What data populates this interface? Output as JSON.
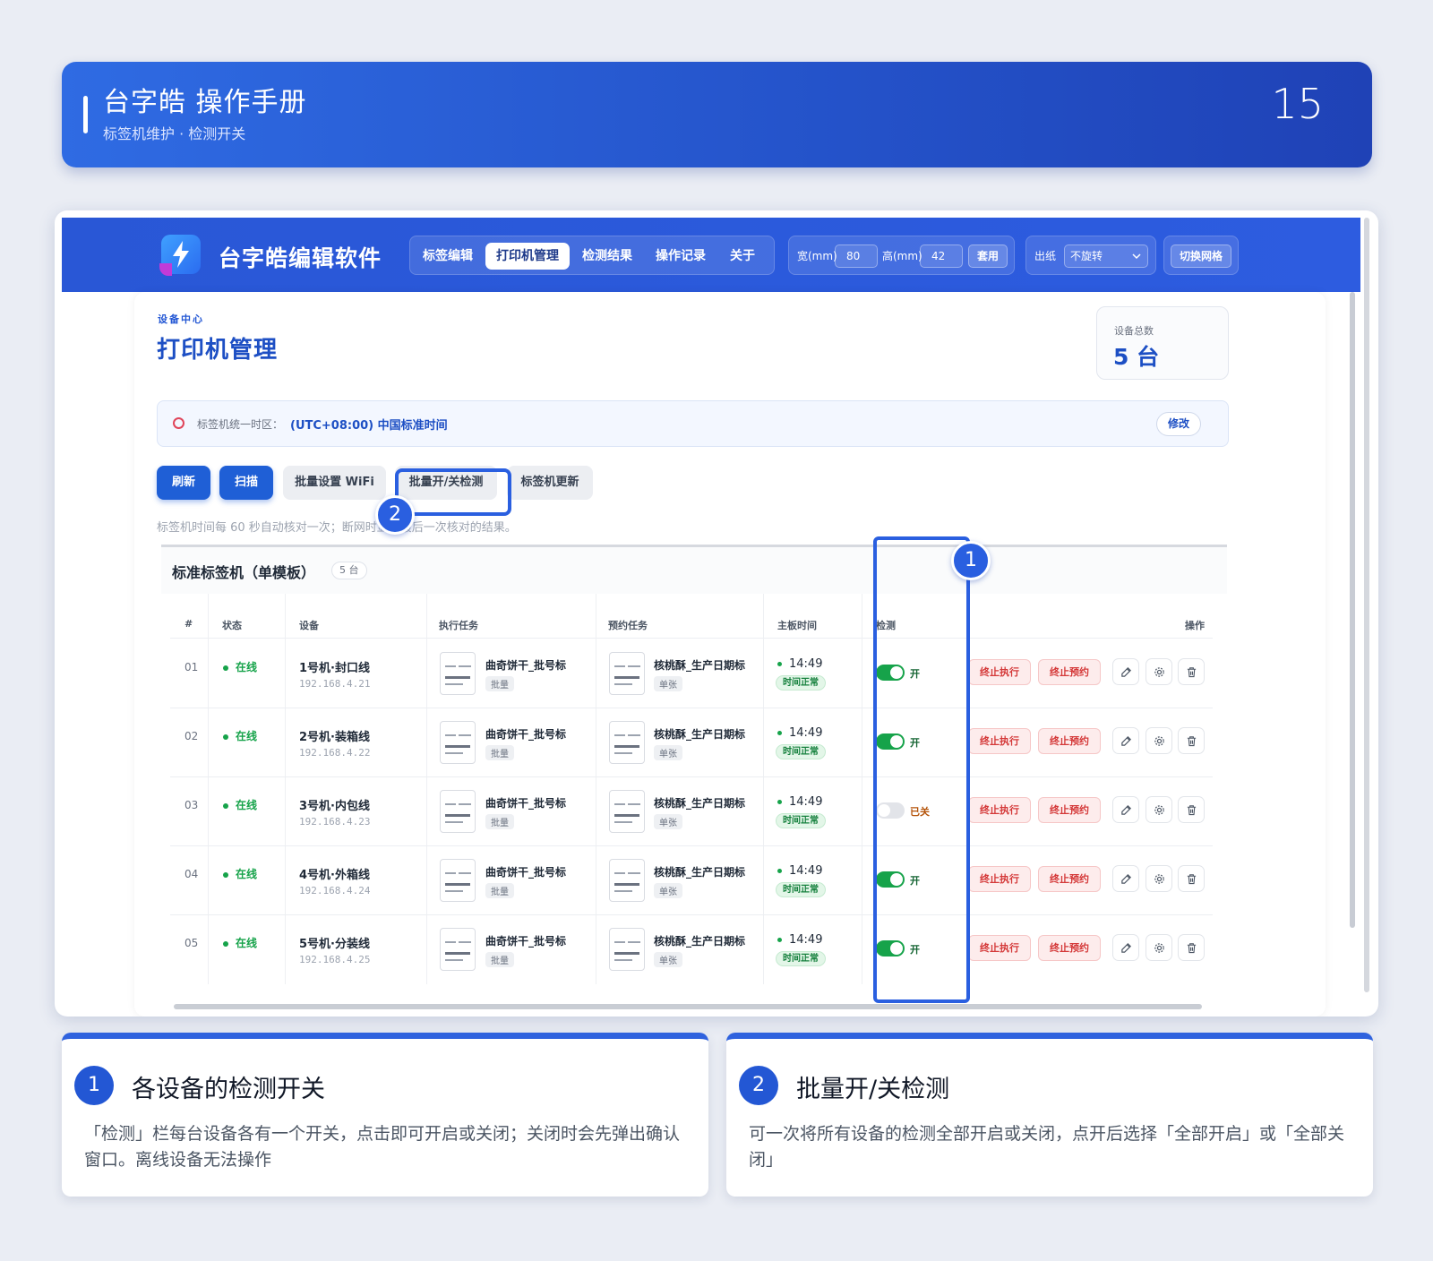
{
  "banner": {
    "title": "台字皓 操作手册",
    "subtitle": "标签机维护 · 检测开关",
    "page_number": "15"
  },
  "app": {
    "name": "台字皓编辑软件",
    "nav": [
      "标签编辑",
      "打印机管理",
      "检测结果",
      "操作记录",
      "关于"
    ],
    "nav_active": "打印机管理",
    "width_label": "宽(mm)",
    "width_value": "80",
    "height_label": "高(mm)",
    "height_value": "42",
    "apply_label": "套用",
    "paper_label": "出纸",
    "paper_option": "不旋转",
    "grid_label": "切换网格"
  },
  "page": {
    "eyebrow": "设备中心",
    "title": "打印机管理",
    "total_label": "设备总数",
    "total_value": "5 台",
    "tz_label": "标签机统一时区：",
    "tz_value": "(UTC+08:00) 中国标准时间",
    "tz_edit": "修改",
    "buttons": {
      "refresh": "刷新",
      "scan": "扫描",
      "wifi": "批量设置 WiFi",
      "batch_detect": "批量开/关检测",
      "update": "标签机更新"
    },
    "hint": "标签机时间每 60 秒自动核对一次；断网时显示最后一次核对的结果。"
  },
  "table": {
    "group_title": "标准标签机（单模板）",
    "group_count": "5 台",
    "columns": [
      "#",
      "状态",
      "设备",
      "执行任务",
      "预约任务",
      "主板时间",
      "检测",
      "操作"
    ],
    "rows": [
      {
        "idx": "01",
        "status": "在线",
        "device": "1号机·封口线",
        "ip": "192.168.4.21",
        "task": "曲奇饼干_批号标",
        "task_tag": "批量",
        "reserve": "核桃酥_生产日期标",
        "reserve_tag": "单张",
        "time": "14:49",
        "time_status": "时间正常",
        "detect_on": true,
        "detect_label": "开"
      },
      {
        "idx": "02",
        "status": "在线",
        "device": "2号机·装箱线",
        "ip": "192.168.4.22",
        "task": "曲奇饼干_批号标",
        "task_tag": "批量",
        "reserve": "核桃酥_生产日期标",
        "reserve_tag": "单张",
        "time": "14:49",
        "time_status": "时间正常",
        "detect_on": true,
        "detect_label": "开"
      },
      {
        "idx": "03",
        "status": "在线",
        "device": "3号机·内包线",
        "ip": "192.168.4.23",
        "task": "曲奇饼干_批号标",
        "task_tag": "批量",
        "reserve": "核桃酥_生产日期标",
        "reserve_tag": "单张",
        "time": "14:49",
        "time_status": "时间正常",
        "detect_on": false,
        "detect_label": "已关"
      },
      {
        "idx": "04",
        "status": "在线",
        "device": "4号机·外箱线",
        "ip": "192.168.4.24",
        "task": "曲奇饼干_批号标",
        "task_tag": "批量",
        "reserve": "核桃酥_生产日期标",
        "reserve_tag": "单张",
        "time": "14:49",
        "time_status": "时间正常",
        "detect_on": true,
        "detect_label": "开"
      },
      {
        "idx": "05",
        "status": "在线",
        "device": "5号机·分装线",
        "ip": "192.168.4.25",
        "task": "曲奇饼干_批号标",
        "task_tag": "批量",
        "reserve": "核桃酥_生产日期标",
        "reserve_tag": "单张",
        "time": "14:49",
        "time_status": "时间正常",
        "detect_on": true,
        "detect_label": "开"
      }
    ],
    "stop_exec": "终止执行",
    "stop_reserve": "终止预约",
    "icons": [
      "edit-icon",
      "gear-icon",
      "trash-icon"
    ]
  },
  "annotations": {
    "badge1": "1",
    "badge2": "2"
  },
  "notes": [
    {
      "num": "1",
      "title": "各设备的检测开关",
      "desc": "「检测」栏每台设备各有一个开关，点击即可开启或关闭；关闭时会先弹出确认窗口。离线设备无法操作"
    },
    {
      "num": "2",
      "title": "批量开/关检测",
      "desc": "可一次将所有设备的检测全部开启或关闭，点开后选择「全部开启」或「全部关闭」"
    }
  ],
  "colors": {
    "accent": "#2357d4",
    "online": "#16a34a",
    "danger": "#d43838"
  }
}
